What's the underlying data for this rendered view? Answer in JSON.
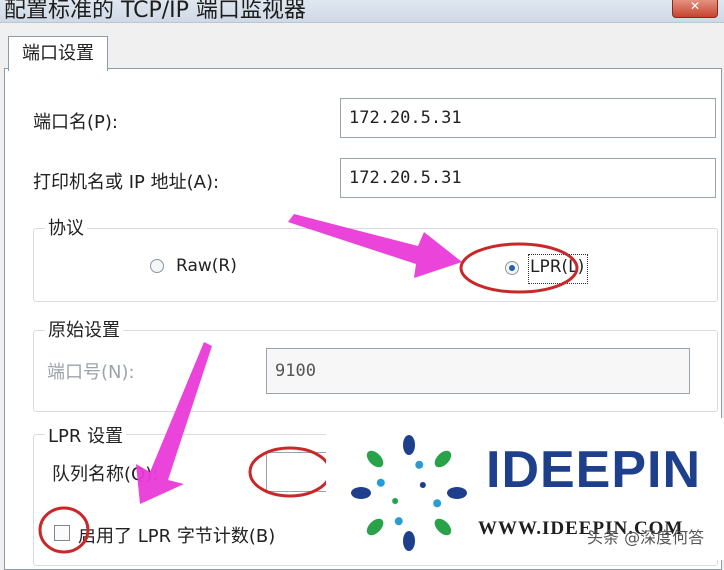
{
  "window": {
    "title": "配置标准的 TCP/IP 端口监视器",
    "close_symbol": "✕"
  },
  "tab": {
    "label": "端口设置"
  },
  "fields": {
    "port_name_label": "端口名(P):",
    "port_name_value": "172.20.5.31",
    "printer_label": "打印机名或 IP 地址(A):",
    "printer_value": "172.20.5.31"
  },
  "protocol": {
    "title": "协议",
    "raw_label": "Raw(R)",
    "lpr_label": "LPR(L)",
    "selected": "LPR"
  },
  "raw_settings": {
    "title": "原始设置",
    "port_number_label": "端口号(N):",
    "port_number_value": "9100"
  },
  "lpr_settings": {
    "title": "LPR 设置",
    "queue_label": "队列名称(Q):",
    "byte_count_label": "启用了 LPR 字节计数(B)"
  },
  "overlay": {
    "logo_text": "IDEEPIN",
    "logo_url": "WWW.IDEEPIN.COM",
    "watermark": "头条 @深度何答",
    "arrow_color": "#e93ad8",
    "circle_color": "#c8282a"
  }
}
